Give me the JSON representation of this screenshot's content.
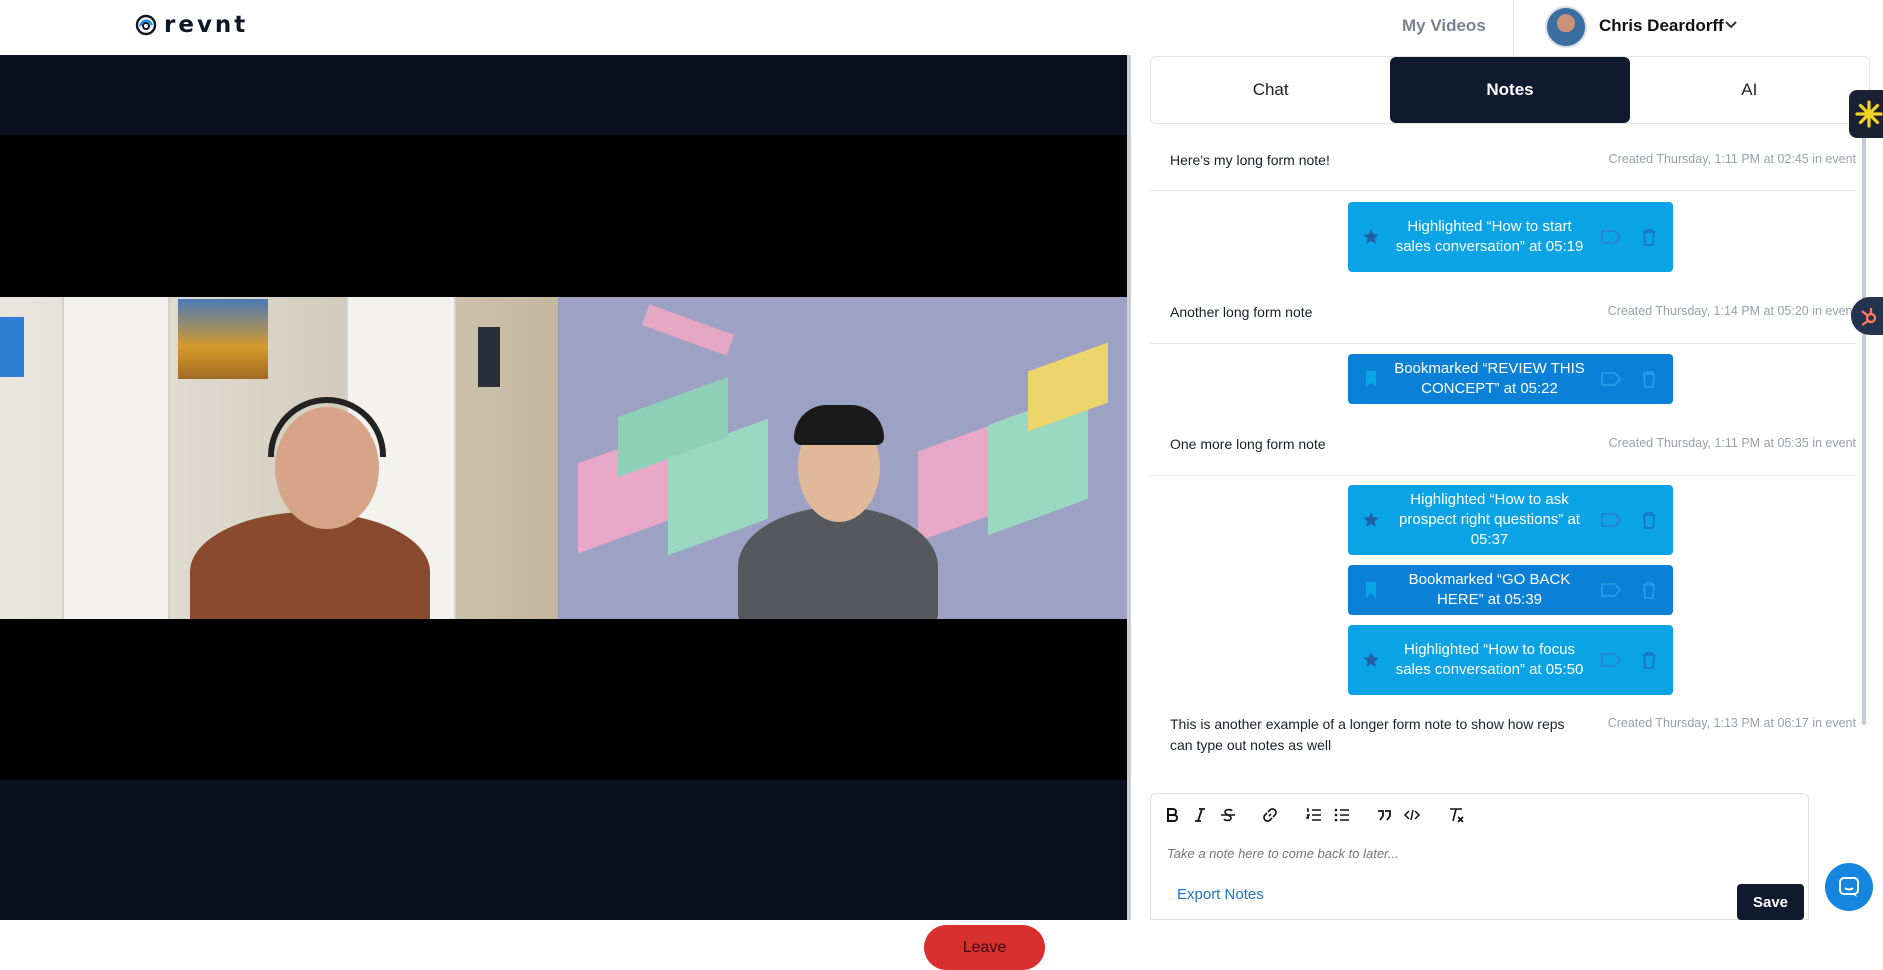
{
  "header": {
    "brand": "revnt",
    "nav_link": "My Videos",
    "user_name": "Chris Deardorff"
  },
  "call": {
    "leave_label": "Leave"
  },
  "tabs": [
    {
      "label": "Chat",
      "active": false
    },
    {
      "label": "Notes",
      "active": true
    },
    {
      "label": "AI",
      "active": false
    }
  ],
  "notes": {
    "items": [
      {
        "text": "Here's my long form note!",
        "meta": "Created Thursday, 1:11 PM at 02:45 in event"
      },
      {
        "text": "Another long form note",
        "meta": "Created Thursday, 1:14 PM at 05:20 in event"
      },
      {
        "text": "One more long form note",
        "meta": "Created Thursday, 1:11 PM at 05:35 in event"
      },
      {
        "text": "This is another example of a longer form note to show how reps can type out notes as well",
        "meta": "Created Thursday, 1:13 PM at 06:17 in event"
      }
    ],
    "events": [
      {
        "kind": "highlight",
        "text": "Highlighted “How to start sales conversation” at 05:19"
      },
      {
        "kind": "bookmark",
        "text": "Bookmarked “REVIEW THIS CONCEPT” at 05:22"
      },
      {
        "kind": "highlight",
        "text": "Highlighted “How to ask prospect right questions” at 05:37"
      },
      {
        "kind": "bookmark",
        "text": "Bookmarked “GO BACK HERE” at 05:39"
      },
      {
        "kind": "highlight",
        "text": "Highlighted “How to focus sales conversation” at 05:50"
      }
    ]
  },
  "editor": {
    "placeholder": "Take a note here to come back to later...",
    "export_label": "Export Notes",
    "save_label": "Save",
    "toolbar": [
      "bold-icon",
      "italic-icon",
      "strikethrough-icon",
      "link-icon",
      "ordered-list-icon",
      "bullet-list-icon",
      "quote-icon",
      "code-icon",
      "clear-format-icon"
    ]
  },
  "colors": {
    "navy": "#101a2e",
    "highlight": "#0aa3e6",
    "bookmark": "#0a80d6",
    "leave": "#d92f2f",
    "link": "#1a74c9"
  }
}
